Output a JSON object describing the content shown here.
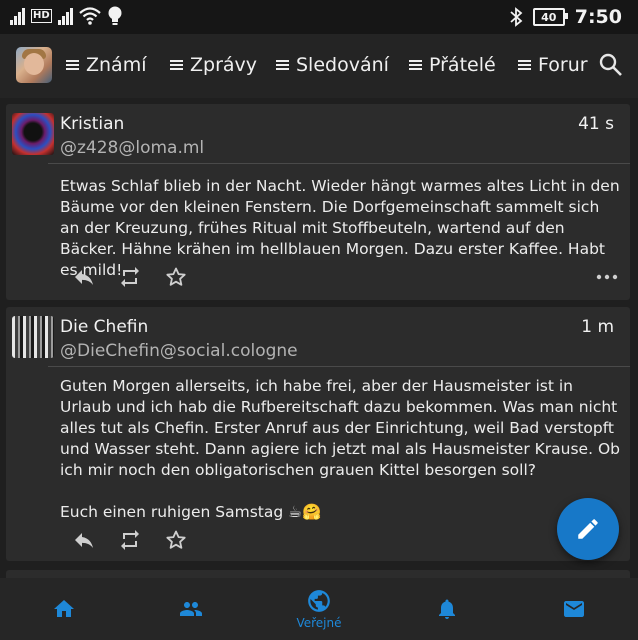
{
  "status_bar": {
    "time": "7:50",
    "battery": "40",
    "hd_label": "HD"
  },
  "tabs": [
    {
      "label": "Známí"
    },
    {
      "label": "Zprávy"
    },
    {
      "label": "Sledování"
    },
    {
      "label": "Přátelé"
    },
    {
      "label": "Forur"
    }
  ],
  "posts": [
    {
      "author": "Kristian",
      "handle": "@z428@loma.ml",
      "time": "41 s",
      "paragraphs": [
        "Etwas Schlaf blieb in der Nacht. Wieder hängt warmes altes Licht in den Bäume vor den kleinen Fenstern. Die Dorfgemeinschaft sammelt sich an der Kreuzung, frühes Ritual mit Stoffbeuteln, wartend auf den Bäcker. Hähne krähen im hellblauen Morgen. Dazu erster Kaffee. Habt es mild!"
      ]
    },
    {
      "author": "Die Chefin",
      "handle": "@DieChefin@social.cologne",
      "time": "1 m",
      "paragraphs": [
        "Guten Morgen allerseits, ich habe frei, aber der Hausmeister ist in Urlaub und ich hab die Rufbereitschaft dazu bekommen. Was man nicht alles tut als Chefin. Erster Anruf aus der Einrichtung, weil Bad verstopft und Wasser steht. Dann agiere ich jetzt mal als Hausmeister Krause. Ob ich mir noch den obligatorischen grauen Kittel besorgen soll?",
        "Euch einen ruhigen Samstag ☕🤗"
      ]
    }
  ],
  "bottom_nav": {
    "active_label": "Veřejné"
  },
  "colors": {
    "accent": "#1e88d8",
    "fab": "#1778c8",
    "background": "#1f1f1f",
    "card": "#2c2c2c"
  },
  "icons": [
    "signal-icon",
    "hd-icon",
    "wifi-icon",
    "bulb-icon",
    "bluetooth-icon",
    "battery-icon",
    "search-icon",
    "reply-icon",
    "boost-icon",
    "favourite-icon",
    "more-icon",
    "edit-icon",
    "home-icon",
    "people-icon",
    "globe-icon",
    "bell-icon",
    "mail-icon"
  ]
}
